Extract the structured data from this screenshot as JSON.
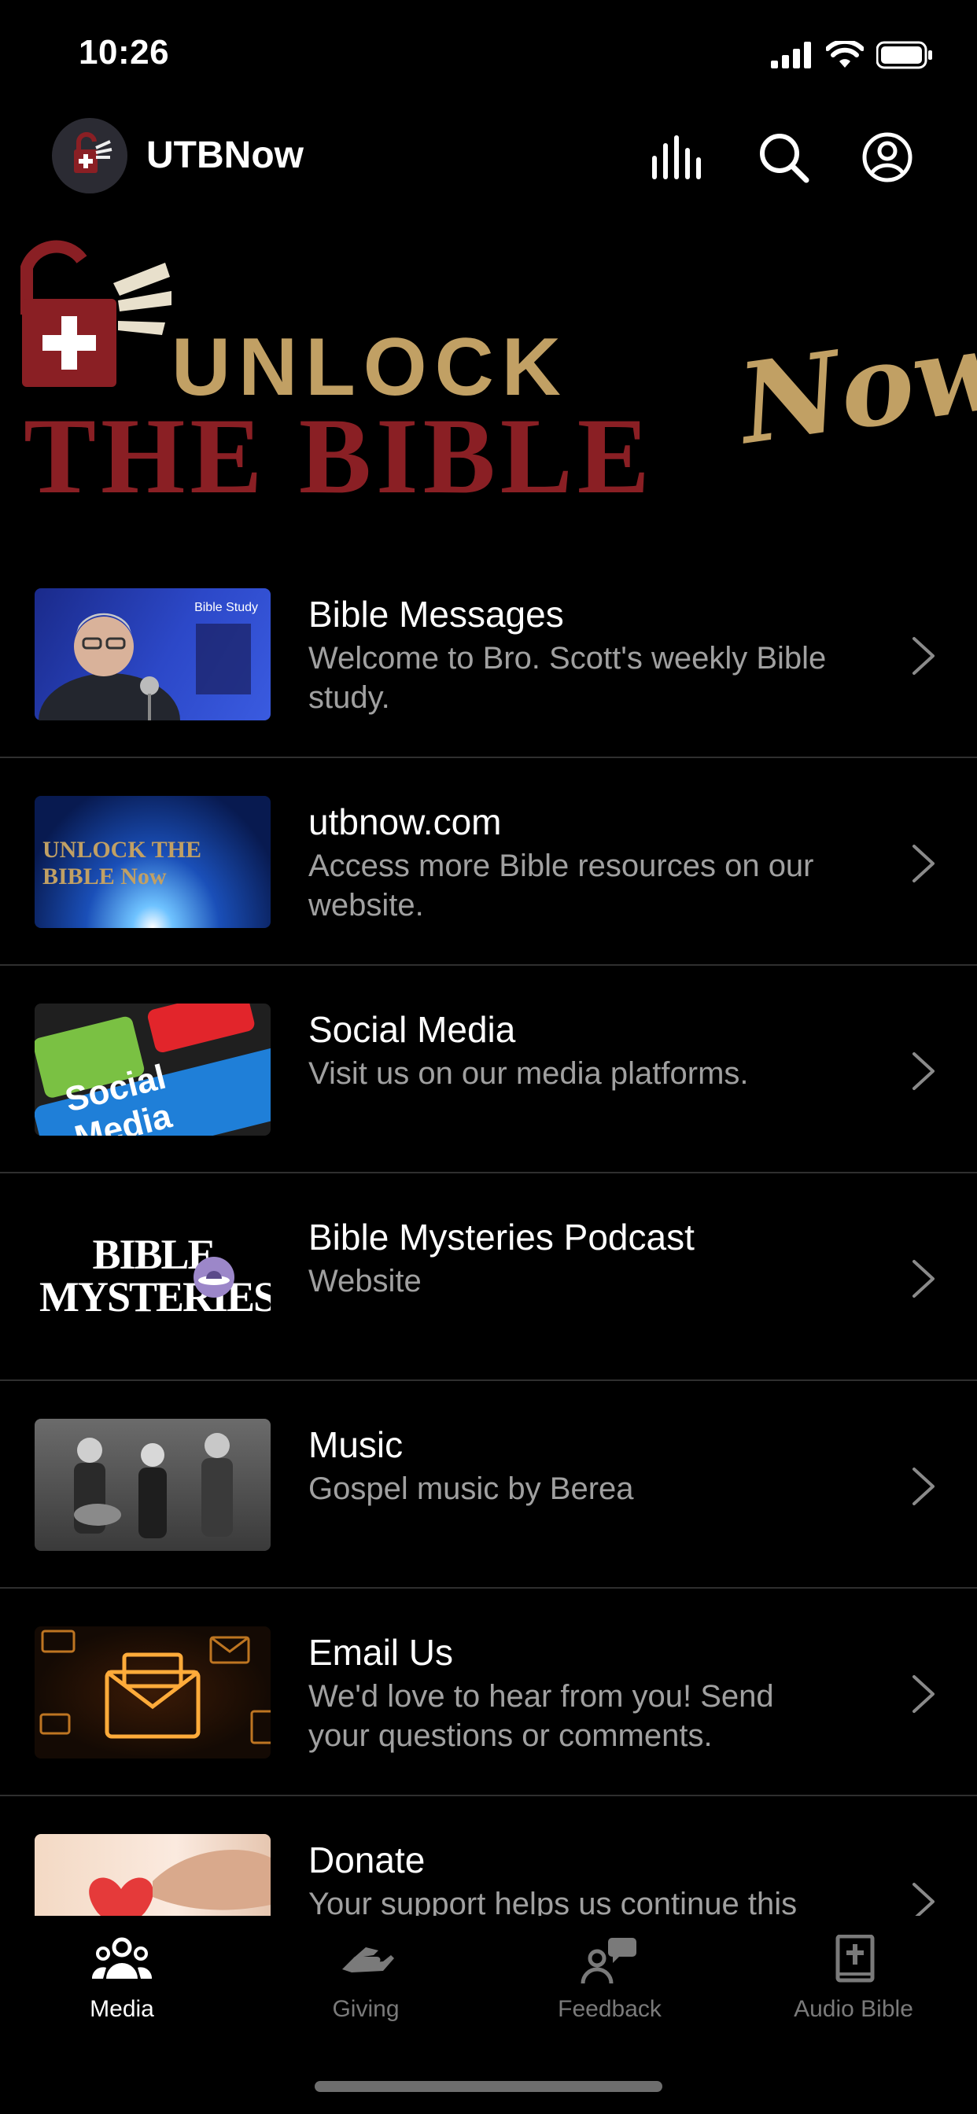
{
  "status_bar": {
    "time": "10:26"
  },
  "header": {
    "app_title": "UTBNow",
    "icons": [
      "logo-icon",
      "audio-bars-icon",
      "search-icon",
      "account-icon"
    ]
  },
  "banner": {
    "unlock": "UNLOCK",
    "the_bible": "THE BIBLE",
    "now": "Now"
  },
  "items": [
    {
      "title": "Bible Messages",
      "subtitle": "Welcome to Bro. Scott's weekly Bible study.",
      "thumb_text": "Bible Study"
    },
    {
      "title": "utbnow.com",
      "subtitle": "Access more Bible resources on our website.",
      "thumb_text": "UNLOCK THE BIBLE Now"
    },
    {
      "title": "Social Media",
      "subtitle": "Visit us on our media platforms.",
      "thumb_text": "Social Media"
    },
    {
      "title": "Bible Mysteries Podcast",
      "subtitle": "Website",
      "thumb_text": "BIBLE MYSTERIES"
    },
    {
      "title": "Music",
      "subtitle": "Gospel music by Berea"
    },
    {
      "title": "Email Us",
      "subtitle": "We'd love to hear from you! Send your questions or comments."
    },
    {
      "title": "Donate",
      "subtitle": "Your support helps us continue this"
    }
  ],
  "tabs": [
    {
      "label": "Media",
      "icon": "group-icon",
      "active": true
    },
    {
      "label": "Giving",
      "icon": "giving-hand-icon",
      "active": false
    },
    {
      "label": "Feedback",
      "icon": "feedback-icon",
      "active": false
    },
    {
      "label": "Audio Bible",
      "icon": "bible-icon",
      "active": false
    }
  ],
  "colors": {
    "accent_gold": "#c1a064",
    "accent_red": "#8a1f24",
    "muted_text": "#a0a0a0"
  }
}
